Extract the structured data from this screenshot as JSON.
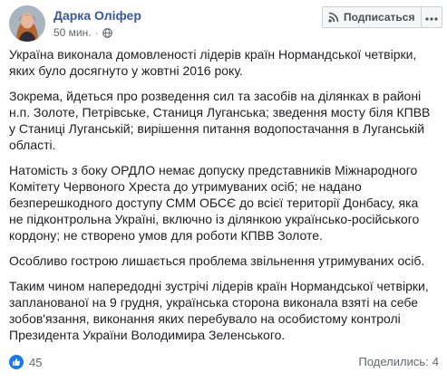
{
  "post": {
    "author": "Дарка Оліфер",
    "time": "50 мин.",
    "subscribe_label": "Подписаться",
    "paragraphs": [
      "Україна виконала домовленості лідерів країн Нормандської четвірки, яких було досягнуто у жовтні 2016 року.",
      "Зокрема, йдеться про розведення сил та засобів на ділянках в районі н.п. Золоте, Петрівське, Станиця Луганська; зведення мосту біля КПВВ у Станиці Луганській; вирішення питання водопостачання в Луганській області.",
      "Натомість з боку ОРДЛО немає допуску представників Міжнародного Комітету Червоного Хреста до утримуваних осіб; не надано безперешкодного доступу СММ ОБСЄ до всієї території Донбасу, яка не підконтрольна Україні, включно із ділянкою українсько-російського кордону; не створено умов для роботи КПВВ Золоте.",
      "Особливо гострою лишається проблема звільнення утримуваних осіб.",
      "Таким чином напередодні зустрічі лідерів країн Нормандської четвірки, запланованої на 9 грудня, українська сторона виконала взяті на себе зобов'язання, виконання яких перебувало на особистому контролі Президента України Володимира Зеленського."
    ]
  },
  "footer": {
    "reactions_count": "45",
    "shares_label": "Поделились:",
    "shares_count": "4"
  },
  "colors": {
    "author_link": "#385898",
    "like_blue": "#1877f2",
    "meta_gray": "#616770"
  },
  "icons": [
    "avatar",
    "globe-icon",
    "rss-icon",
    "more-icon",
    "like-icon"
  ]
}
